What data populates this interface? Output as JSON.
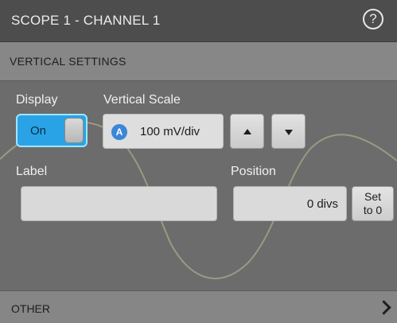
{
  "header": {
    "title": "SCOPE 1 - CHANNEL 1",
    "help_icon": "help-icon",
    "help_glyph": "?"
  },
  "section": {
    "title": "VERTICAL SETTINGS"
  },
  "display": {
    "label": "Display",
    "toggle_state": "On",
    "accent_color": "#2aa3e6"
  },
  "vertical_scale": {
    "label": "Vertical Scale",
    "badge": "A",
    "badge_icon": "knob-a-icon",
    "value": "100 mV/div",
    "increase_icon": "arrow-up-icon",
    "decrease_icon": "arrow-down-icon"
  },
  "label_field": {
    "label": "Label",
    "value": ""
  },
  "position": {
    "label": "Position",
    "value": "0 divs",
    "set_button_line1": "Set",
    "set_button_line2": "to 0"
  },
  "footer": {
    "title": "OTHER",
    "chevron_icon": "chevron-right-icon"
  }
}
